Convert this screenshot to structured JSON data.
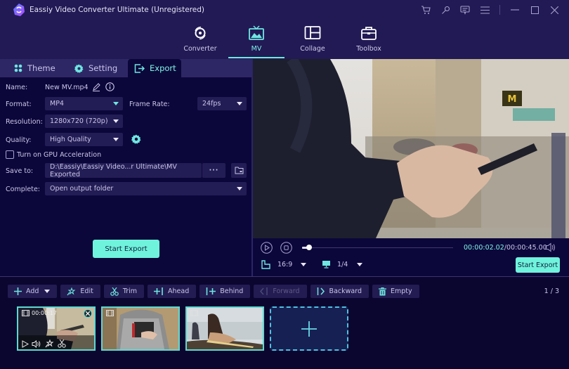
{
  "app": {
    "title": "Eassiy Video Converter Ultimate (Unregistered)"
  },
  "window_controls": [
    "cart-icon",
    "key-icon",
    "feedback-icon",
    "menu-icon",
    "minimize-icon",
    "maximize-icon",
    "close-icon"
  ],
  "nav": {
    "items": [
      {
        "label": "Converter",
        "icon": "converter-icon",
        "active": false
      },
      {
        "label": "MV",
        "icon": "mv-icon",
        "active": true
      },
      {
        "label": "Collage",
        "icon": "collage-icon",
        "active": false
      },
      {
        "label": "Toolbox",
        "icon": "toolbox-icon",
        "active": false
      }
    ]
  },
  "tabs": [
    {
      "label": "Theme",
      "icon": "theme-icon"
    },
    {
      "label": "Setting",
      "icon": "gear-icon"
    },
    {
      "label": "Export",
      "icon": "export-icon",
      "active": true
    }
  ],
  "export": {
    "name_label": "Name:",
    "name_value": "New MV.mp4",
    "format_label": "Format:",
    "format_value": "MP4",
    "frame_rate_label": "Frame Rate:",
    "frame_rate_value": "24fps",
    "resolution_label": "Resolution:",
    "resolution_value": "1280x720 (720p)",
    "quality_label": "Quality:",
    "quality_value": "High Quality",
    "gpu_label": "Turn on GPU Acceleration",
    "gpu_checked": false,
    "save_label": "Save to:",
    "save_path": "D:\\Eassiy\\Eassiy Video...r Ultimate\\MV Exported",
    "browse_label": "···",
    "complete_label": "Complete:",
    "complete_value": "Open output folder",
    "start_export_label": "Start Export"
  },
  "player": {
    "current_time": "00:00:02.02",
    "total_time": "/00:00:45.00",
    "progress": 0.045,
    "aspect_ratio": "16:9",
    "zoom": "1/4",
    "start_export_label": "Start Export"
  },
  "toolbar": {
    "buttons": [
      {
        "label": "Add",
        "icon": "plus-icon",
        "dropdown": true
      },
      {
        "label": "Edit",
        "icon": "edit-wand-icon"
      },
      {
        "label": "Trim",
        "icon": "scissors-icon"
      },
      {
        "label": "Ahead",
        "icon": "add-ahead-icon"
      },
      {
        "label": "Behind",
        "icon": "add-behind-icon"
      },
      {
        "label": "Forward",
        "icon": "forward-icon",
        "disabled": true
      },
      {
        "label": "Backward",
        "icon": "backward-icon"
      },
      {
        "label": "Empty",
        "icon": "trash-icon"
      }
    ],
    "pager": "1 / 3"
  },
  "clips": [
    {
      "duration": "00:00:17",
      "selected": true
    },
    {
      "duration": ""
    },
    {
      "duration": ""
    }
  ],
  "colors": {
    "accent": "#6ff3dd",
    "title_bg": "#211a55",
    "panel_bg": "#0c073a"
  }
}
